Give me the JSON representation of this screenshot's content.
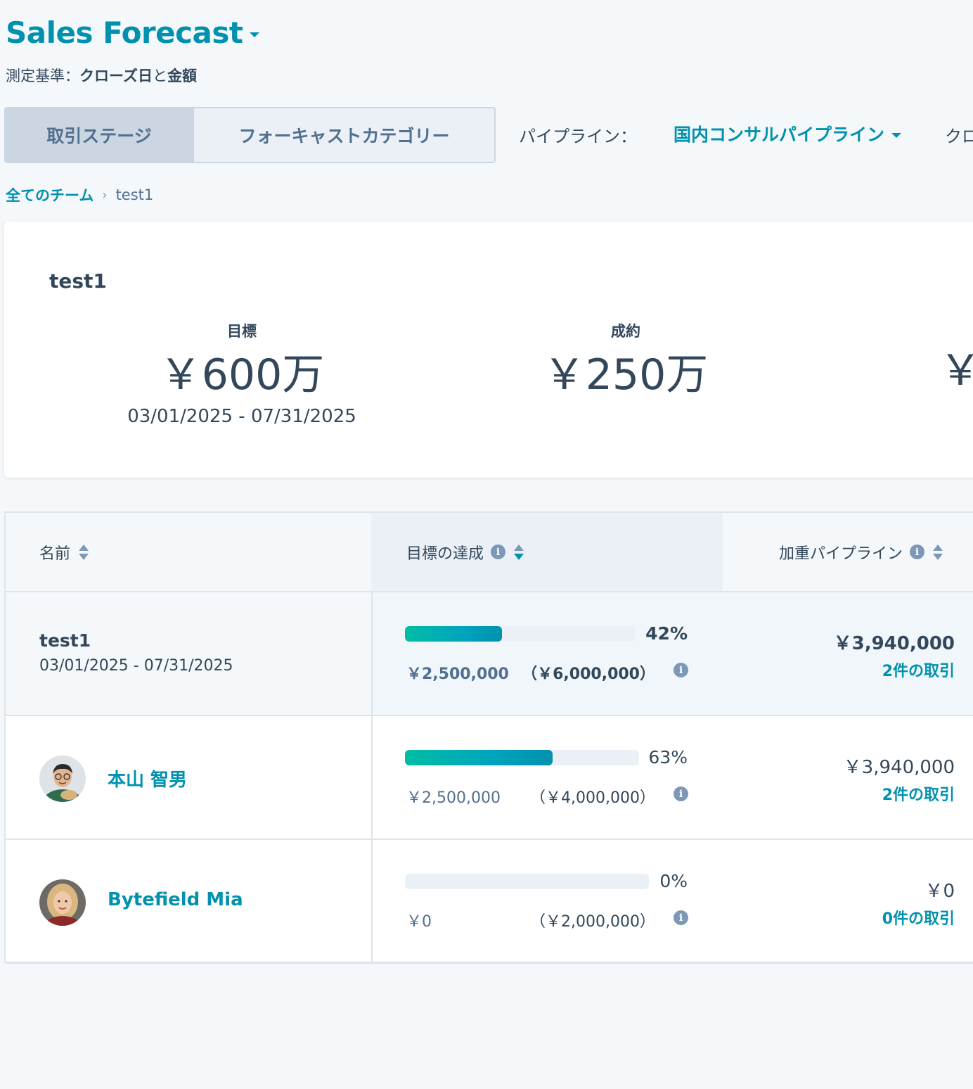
{
  "header": {
    "title": "Sales Forecast",
    "measure_prefix": "測定基準：",
    "measure_a": "クローズ日",
    "measure_and": "と",
    "measure_b": "金額"
  },
  "view_toggle": {
    "options": [
      "取引ステージ",
      "フォーキャストカテゴリー"
    ],
    "selected": "取引ステージ"
  },
  "pipeline": {
    "label": "パイプライン：",
    "value": "国内コンサルパイプライン",
    "next_label_partial": "クロ"
  },
  "breadcrumb": {
    "root": "全てのチーム",
    "separator": "›",
    "current": "test1"
  },
  "summary": {
    "name": "test1",
    "stats": [
      {
        "label": "目標",
        "value": "￥600万",
        "sub": "03/01/2025 - 07/31/2025"
      },
      {
        "label": "成約",
        "value": "￥250万",
        "sub": ""
      }
    ],
    "cut_value": "￥"
  },
  "table": {
    "columns": [
      "名前",
      "目標の達成",
      "加重パイプライン"
    ],
    "rows": [
      {
        "type": "team",
        "name": "test1",
        "date": "03/01/2025 - 07/31/2025",
        "progress_percent": 42,
        "percent_label": "42%",
        "closed": "￥2,500,000",
        "goal": "（￥6,000,000）",
        "weighted": "￥3,940,000",
        "deals": "2件の取引"
      },
      {
        "type": "user",
        "name": "本山 智男",
        "progress_percent": 63,
        "percent_label": "63%",
        "closed": "￥2,500,000",
        "goal": "（￥4,000,000）",
        "weighted": "￥3,940,000",
        "deals": "2件の取引"
      },
      {
        "type": "user",
        "name": "Bytefield Mia",
        "progress_percent": 0,
        "percent_label": "0%",
        "closed": "￥0",
        "goal": "（￥2,000,000）",
        "weighted": "￥0",
        "deals": "0件の取引"
      }
    ]
  },
  "colors": {
    "accent": "#0091ae",
    "text": "#33475b",
    "bar_start": "#00bda5",
    "bar_end": "#0091ae"
  }
}
